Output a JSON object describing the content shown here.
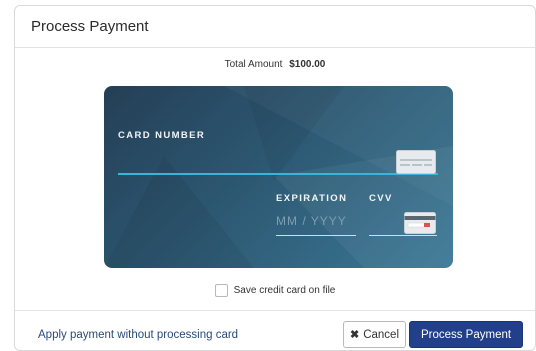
{
  "modal": {
    "title": "Process Payment"
  },
  "total": {
    "label": "Total Amount",
    "amount": "$100.00"
  },
  "card": {
    "number_label": "CARD NUMBER",
    "expiration_label": "EXPIRATION",
    "expiration_placeholder": "MM / YYYY",
    "cvv_label": "CVV",
    "front_icon": "credit-card-front-icon",
    "back_icon": "credit-card-back-icon"
  },
  "save_card": {
    "label": "Save credit card on file",
    "checked": false
  },
  "footer": {
    "apply_link": "Apply payment without processing card",
    "cancel_label": "Cancel",
    "process_label": "Process Payment"
  },
  "colors": {
    "primary_button": "#213f8b",
    "link": "#2a4a7c",
    "card_dark": "#243f56",
    "card_light": "#3b7896",
    "accent_line": "#39b5d8"
  }
}
